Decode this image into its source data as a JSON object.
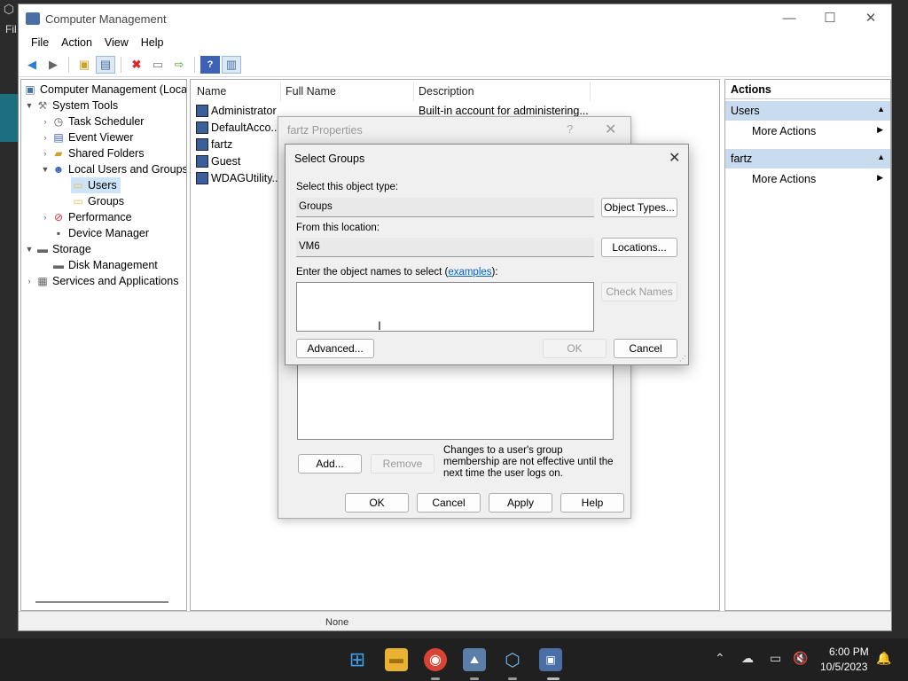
{
  "window": {
    "title": "Computer Management",
    "controls": {
      "minimize": "—",
      "maximize": "☐",
      "close": "✕"
    }
  },
  "desktop": {
    "left_text": "Fil"
  },
  "menu": [
    "File",
    "Action",
    "View",
    "Help"
  ],
  "tree": {
    "root": "Computer Management (Local",
    "items": [
      {
        "label": "System Tools",
        "icon": "tools-icon"
      },
      {
        "label": "Task Scheduler",
        "icon": "clock-icon"
      },
      {
        "label": "Event Viewer",
        "icon": "event-viewer-icon"
      },
      {
        "label": "Shared Folders",
        "icon": "shared-folder-icon"
      },
      {
        "label": "Local Users and Groups",
        "icon": "users-icon"
      },
      {
        "label": "Users",
        "icon": "folder-icon"
      },
      {
        "label": "Groups",
        "icon": "folder-icon"
      },
      {
        "label": "Performance",
        "icon": "performance-icon"
      },
      {
        "label": "Device Manager",
        "icon": "device-manager-icon"
      },
      {
        "label": "Storage",
        "icon": "storage-icon"
      },
      {
        "label": "Disk Management",
        "icon": "disk-icon"
      },
      {
        "label": "Services and Applications",
        "icon": "services-icon"
      }
    ]
  },
  "list": {
    "columns": [
      "Name",
      "Full Name",
      "Description"
    ],
    "rows": [
      {
        "name": "Administrator",
        "description": "Built-in account for administering..."
      },
      {
        "name": "DefaultAcco..."
      },
      {
        "name": "fartz"
      },
      {
        "name": "Guest"
      },
      {
        "name": "WDAGUtility..."
      }
    ]
  },
  "actions": {
    "header": "Actions",
    "sections": [
      {
        "title": "Users",
        "item": "More Actions"
      },
      {
        "title": "fartz",
        "item": "More Actions"
      }
    ]
  },
  "status": {
    "text": "None"
  },
  "props_dialog": {
    "title": "fartz Properties",
    "help": "?",
    "close": "✕",
    "add": "Add...",
    "remove": "Remove",
    "note": "Changes to a user's group membership are not effective until the next time the user logs on.",
    "ok": "OK",
    "cancel": "Cancel",
    "apply": "Apply",
    "help_button": "Help"
  },
  "select_groups": {
    "title": "Select Groups",
    "close": "✕",
    "object_type_label": "Select this object type:",
    "object_type_value": "Groups",
    "object_types_button": "Object Types...",
    "location_label": "From this location:",
    "location_value": "VM6",
    "locations_button": "Locations...",
    "names_label_pre": "Enter the object names to select (",
    "names_label_link": "examples",
    "names_label_post": "):",
    "names_value": "",
    "check_names": "Check Names",
    "advanced": "Advanced...",
    "ok": "OK",
    "cancel": "Cancel"
  },
  "taskbar": {
    "time": "6:00 PM",
    "date": "10/5/2023"
  }
}
